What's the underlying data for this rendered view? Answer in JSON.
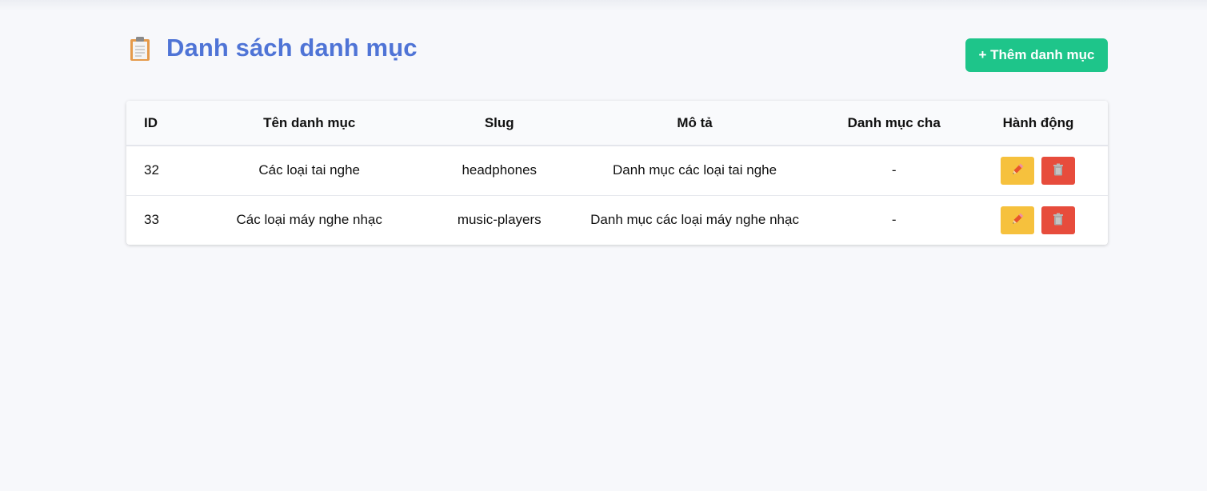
{
  "header": {
    "title": "Danh sách danh mục",
    "title_icon": "clipboard-icon",
    "add_button_label": "+ Thêm danh mục"
  },
  "table": {
    "columns": [
      "ID",
      "Tên danh mục",
      "Slug",
      "Mô tả",
      "Danh mục cha",
      "Hành động"
    ],
    "rows": [
      {
        "id": "32",
        "name": "Các loại tai nghe",
        "slug": "headphones",
        "description": "Danh mục các loại tai nghe",
        "parent": "-",
        "edit_icon": "pencil-icon",
        "delete_icon": "trash-icon"
      },
      {
        "id": "33",
        "name": "Các loại máy nghe nhạc",
        "slug": "music-players",
        "description": "Danh mục các loại máy nghe nhạc",
        "parent": "-",
        "edit_icon": "pencil-icon",
        "delete_icon": "trash-icon"
      }
    ]
  },
  "colors": {
    "title": "#4f74d6",
    "add_button": "#1ec58a",
    "edit_button": "#f6c13d",
    "delete_button": "#e74c3c",
    "background": "#f7f8fb"
  }
}
